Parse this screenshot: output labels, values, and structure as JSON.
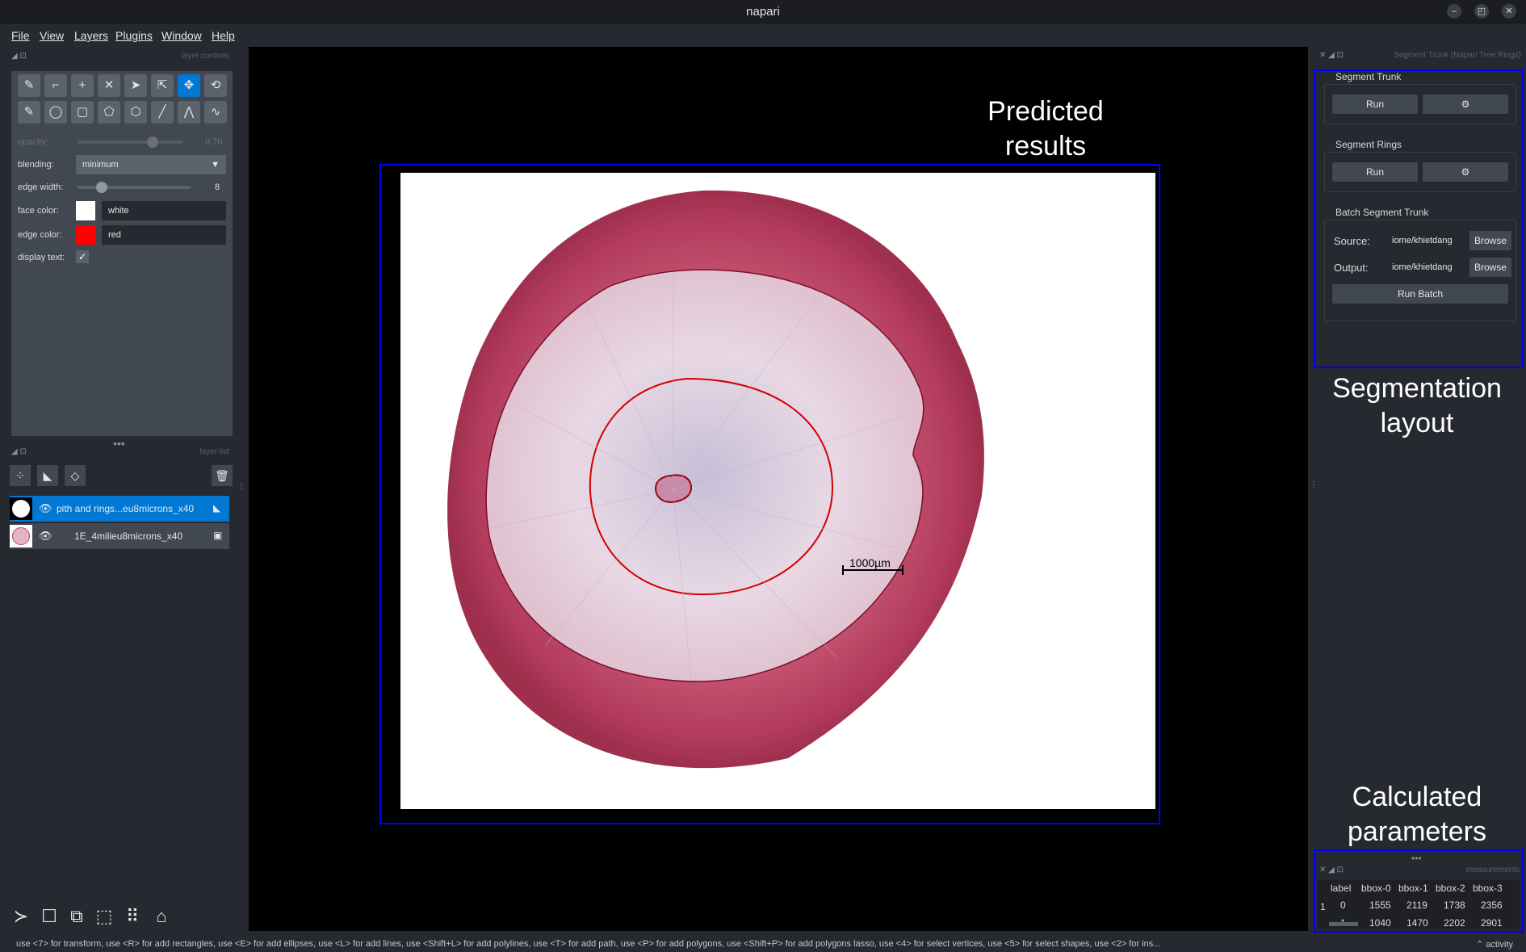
{
  "window": {
    "title": "napari",
    "controls": [
      "–",
      "◰",
      "✕"
    ]
  },
  "menu": [
    "File",
    "View",
    "Layers",
    "Plugins",
    "Window",
    "Help"
  ],
  "layer_controls": {
    "header": "layer controls",
    "opacity_label": "opacity:",
    "opacity_value": "0.70",
    "blending_label": "blending:",
    "blending_value": "minimum",
    "edge_width_label": "edge width:",
    "edge_width_value": "8",
    "face_color_label": "face color:",
    "face_color_value": "white",
    "face_color_hex": "#ffffff",
    "edge_color_label": "edge color:",
    "edge_color_value": "red",
    "edge_color_hex": "#ff0000",
    "display_text_label": "display text:",
    "display_text_checked": true
  },
  "layer_list": {
    "header": "layer list",
    "layers": [
      {
        "name": "pith and rings...eu8microns_x40",
        "selected": true,
        "type": "shapes"
      },
      {
        "name": "1E_4milieu8microns_x40",
        "selected": false,
        "type": "image"
      }
    ]
  },
  "canvas": {
    "scale_bar": "1000µm",
    "annotation_predicted": "Predicted\nresults",
    "annotation_segmentation": "Segmentation\nlayout",
    "annotation_parameters": "Calculated\nparameters"
  },
  "right_dock": {
    "header": "Segment Trunk (Napari Tree Rings)",
    "segment_trunk": {
      "title": "Segment Trunk",
      "run": "Run"
    },
    "segment_rings": {
      "title": "Segment Rings",
      "run": "Run"
    },
    "batch": {
      "title": "Batch Segment Trunk",
      "source_label": "Source:",
      "source_value": "iome/khietdang",
      "output_label": "Output:",
      "output_value": "iome/khietdang",
      "browse": "Browse",
      "run_batch": "Run Batch"
    }
  },
  "measurements": {
    "header": "measurements",
    "columns": [
      "label",
      "bbox-0",
      "bbox-1",
      "bbox-2",
      "bbox-3"
    ],
    "rows": [
      [
        "0",
        "1555",
        "2119",
        "1738",
        "2356"
      ],
      [
        "1",
        "1040",
        "1470",
        "2202",
        "2901"
      ]
    ],
    "row_index": "1"
  },
  "status_bar": {
    "text": "use <7> for transform, use <R> for add rectangles, use <E> for add ellipses, use <L> for add lines, use <Shift+L> for add polylines, use <T> for add path, use <P> for add polygons, use <Shift+P> for add polygons lasso, use <4> for select vertices, use <5> for select shapes, use <2> for ins...",
    "activity": "activity"
  }
}
